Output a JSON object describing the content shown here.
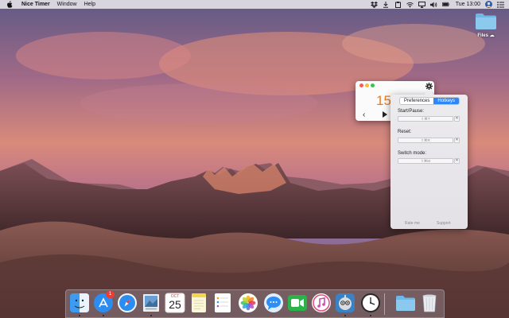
{
  "menubar": {
    "app_name": "Nice Timer",
    "menus": [
      "Window",
      "Help"
    ],
    "clock": "Tue 13:00",
    "status_icons": [
      "dropbox-icon",
      "download-icon",
      "clipboard-icon",
      "wifi-icon",
      "airplay-icon",
      "volume-icon",
      "battery-icon",
      "avatar",
      "list-icon"
    ]
  },
  "desktop": {
    "folder_label": "Files"
  },
  "timer": {
    "digits": "15"
  },
  "preferences": {
    "tabs": [
      "Preferences",
      "Hotkeys"
    ],
    "active_tab": "Hotkeys",
    "fields": [
      {
        "label": "Start/Pause:",
        "value": "⇧⌘T"
      },
      {
        "label": "Reset:",
        "value": "⇧⌘R"
      },
      {
        "label": "Switch mode:",
        "value": "⇧⌘M"
      }
    ],
    "clear_glyph": "✕",
    "footer": {
      "rate": "Rate me",
      "support": "Support"
    }
  },
  "dock": {
    "items": [
      "finder-icon",
      "app-store-icon",
      "safari-icon",
      "mail-icon",
      "calendar-icon",
      "notes-icon",
      "reminders-icon",
      "photos-icon",
      "messages-icon",
      "facetime-icon",
      "itunes-icon",
      "tweetbot-icon",
      "clock-icon",
      "downloads-folder-icon",
      "trash-icon"
    ],
    "app_store_badge": "1",
    "calendar_month": "OCT",
    "calendar_day": "25"
  },
  "colors": {
    "accent": "#2f86f6",
    "timer_digits": "#f07a1a",
    "close": "#fc5b57",
    "minimize": "#fdbc2e",
    "zoom": "#33c748"
  }
}
